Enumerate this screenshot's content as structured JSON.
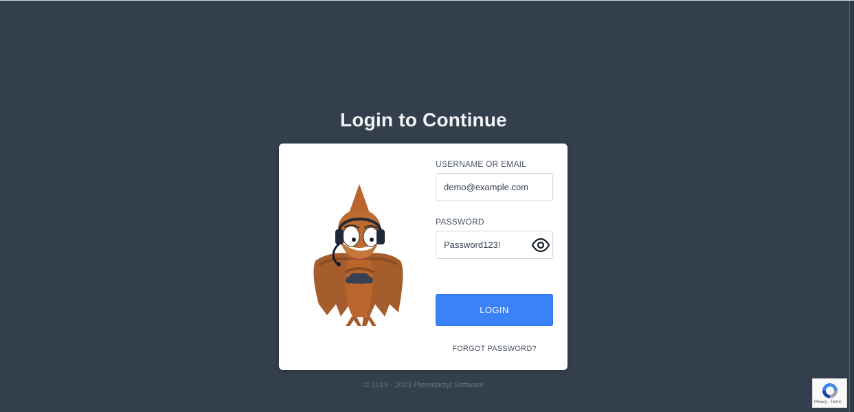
{
  "page": {
    "title": "Login to Continue",
    "footer": "© 2015 - 2023 Pterodactyl Software"
  },
  "form": {
    "username": {
      "label": "USERNAME OR EMAIL",
      "value": "demo@example.com"
    },
    "password": {
      "label": "PASSWORD",
      "value": "Password123!",
      "visibility_icon": "eye-icon"
    },
    "login_label": "LOGIN",
    "forgot_label": "FORGOT PASSWORD?"
  },
  "recaptcha": {
    "privacy_label": "Privacy",
    "separator": " - ",
    "terms_label": "Terms"
  },
  "colors": {
    "background": "#333f4d",
    "card": "#ffffff",
    "primary_button": "#3b82f6",
    "title_text": "#f2f4f6"
  }
}
